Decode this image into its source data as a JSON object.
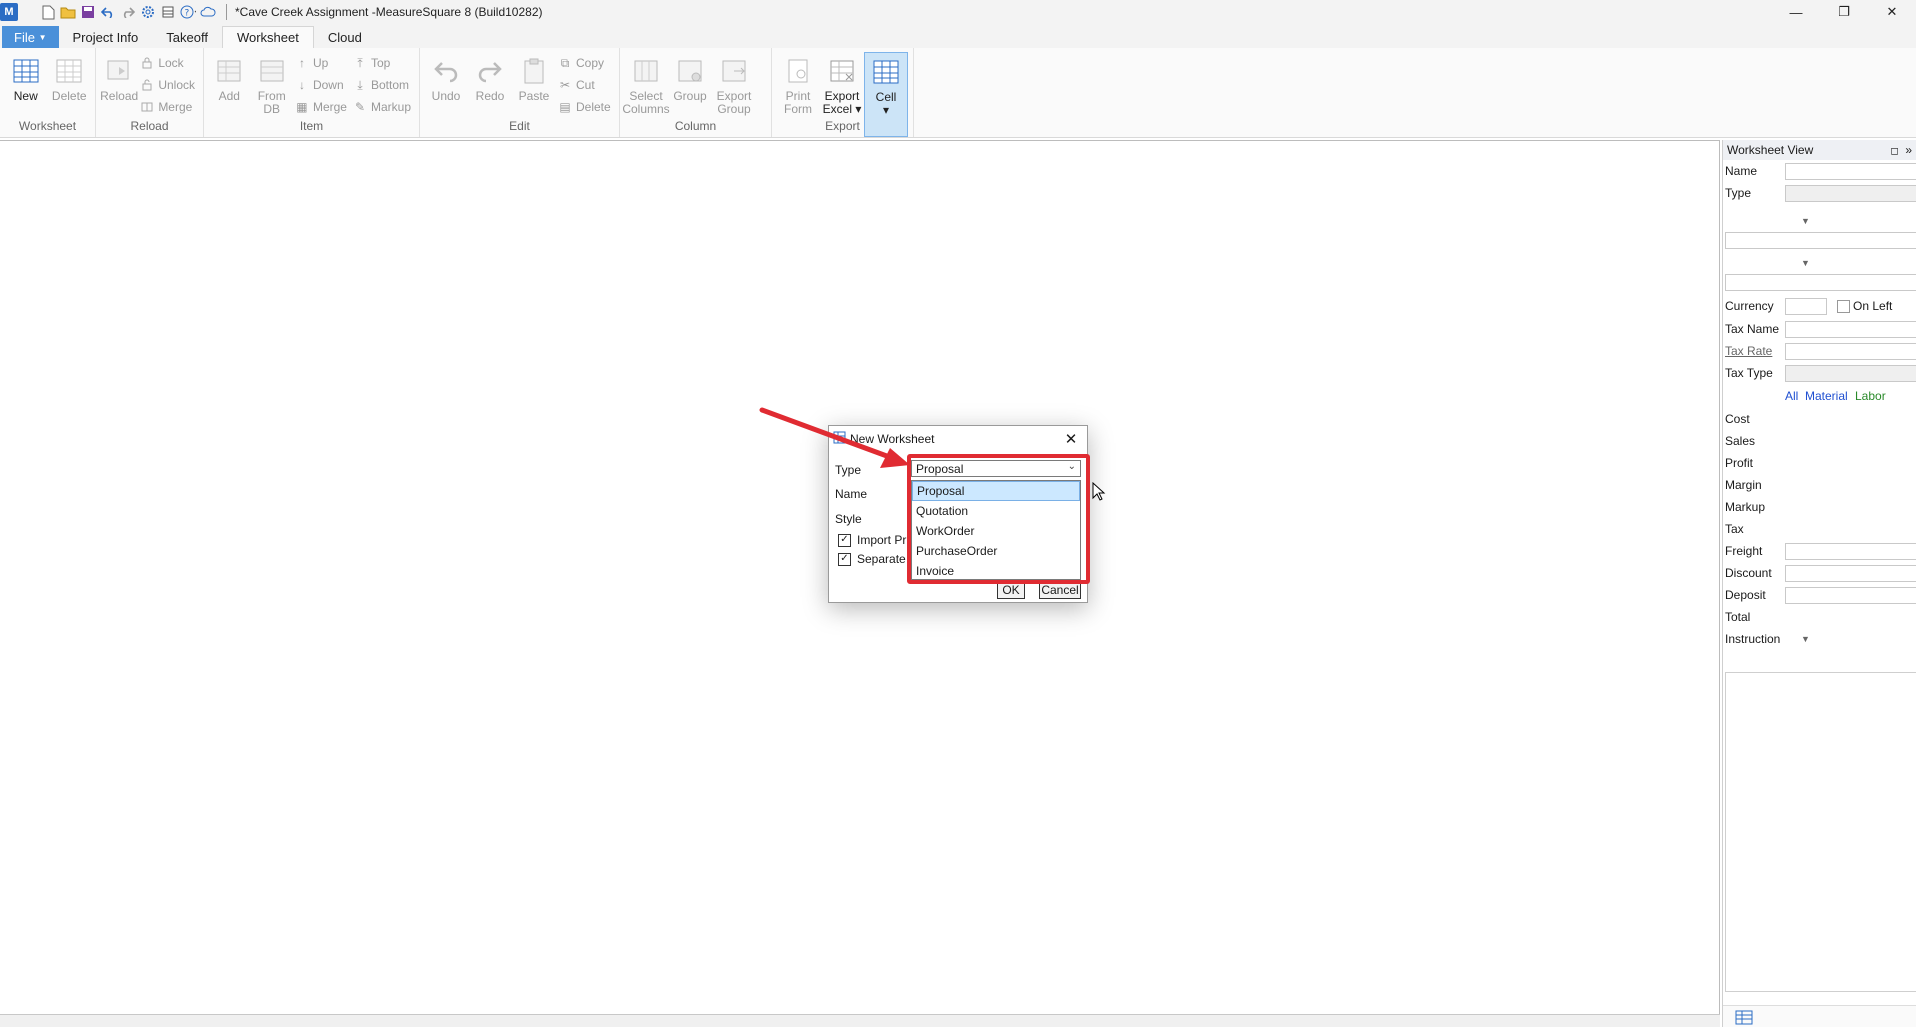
{
  "window": {
    "title": "*Cave Creek Assignment -MeasureSquare 8 (Build10282)",
    "app_icon": "M",
    "minimize": "—",
    "restore": "❐",
    "close": "✕"
  },
  "tabs": [
    "Project Info",
    "Takeoff",
    "Worksheet",
    "Cloud"
  ],
  "file_tab": "File",
  "ribbon": {
    "worksheet_group": {
      "label": "Worksheet",
      "new": "New",
      "delete": "Delete"
    },
    "reload_group": {
      "label": "Reload",
      "reload": "Reload",
      "lock": "Lock",
      "unlock": "Unlock",
      "merge": "Merge"
    },
    "item_group": {
      "label": "Item",
      "add": "Add",
      "from_db": "From\nDB",
      "up": "Up",
      "down": "Down",
      "merge": "Merge",
      "top": "Top",
      "bottom": "Bottom",
      "markup": "Markup"
    },
    "edit_group": {
      "label": "Edit",
      "undo": "Undo",
      "redo": "Redo",
      "paste": "Paste",
      "copy": "Copy",
      "cut": "Cut",
      "delete": "Delete"
    },
    "column_group": {
      "label": "Column",
      "select_columns": "Select\nColumns",
      "group": "Group",
      "export_group": "Export\nGroup"
    },
    "export_group": {
      "label": "Export",
      "print_form": "Print\nForm",
      "export_excel": "Export\nExcel ▾",
      "cell": "Cell\n▾"
    }
  },
  "right_panel": {
    "title": "Worksheet View",
    "name": "Name",
    "type": "Type",
    "currency": "Currency",
    "on_left": "On Left",
    "tax_name": "Tax Name",
    "tax_rate": "Tax Rate",
    "tax_type": "Tax Type",
    "filter_all": "All",
    "filter_material": "Material",
    "filter_labor": "Labor",
    "cost": "Cost",
    "sales": "Sales",
    "profit": "Profit",
    "margin": "Margin",
    "markup": "Markup",
    "tax": "Tax",
    "freight": "Freight",
    "discount": "Discount",
    "deposit": "Deposit",
    "total": "Total",
    "instruction": "Instruction"
  },
  "dialog": {
    "title": "New Worksheet",
    "type_label": "Type",
    "name_label": "Name",
    "style_label": "Style",
    "check_import": "Import Pr",
    "check_separate": "Separate",
    "ok": "OK",
    "cancel": "Cancel",
    "selected_type": "Proposal",
    "options": [
      "Proposal",
      "Quotation",
      "WorkOrder",
      "PurchaseOrder",
      "Invoice"
    ]
  },
  "colors": {
    "highlight": "#e02b32",
    "file_tab": "#4a90d9",
    "material": "#1f4fd1",
    "labor": "#2a8a2a"
  }
}
